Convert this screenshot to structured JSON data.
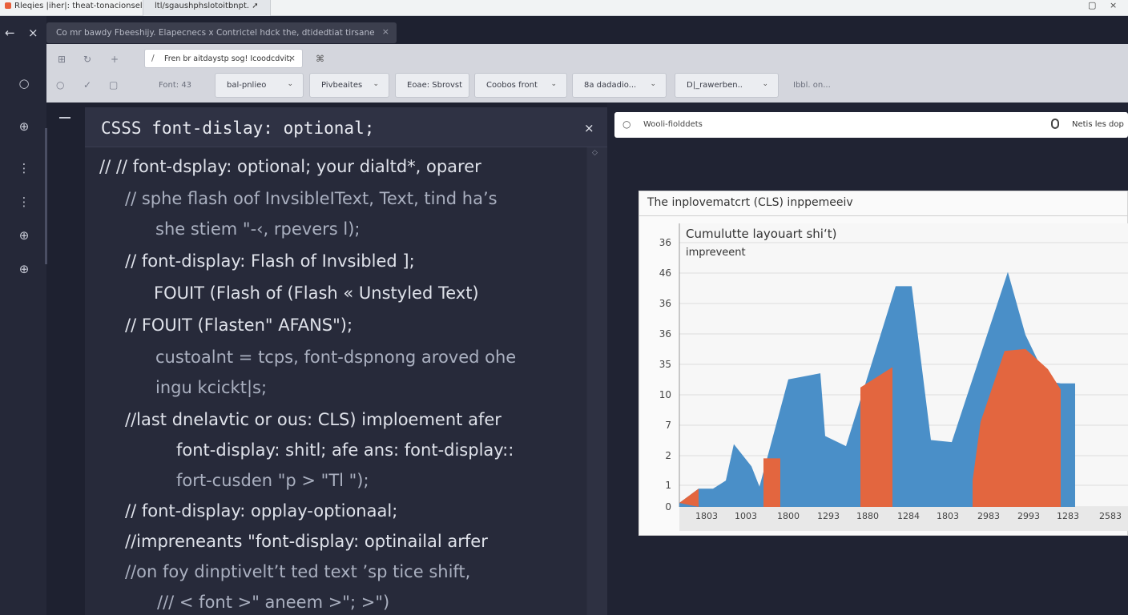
{
  "browser": {
    "tab1_title": "Rleqies |iher|: theat-tonacionsel",
    "tab2_title": "ltl/sgaushphslotoitbnpt.",
    "tab2_icon": "share-icon",
    "window_controls": [
      "▢",
      "×"
    ]
  },
  "header": {
    "address_text": "Co mr bawdy Fbeeshijy. Elapecnecs x Contrictel hdck the, dtidedtiat tirsane",
    "back_icon": "←",
    "close_icon": "×",
    "addr_close": "×"
  },
  "rail": {
    "icons": [
      "○",
      "⊕",
      "⋮",
      "⋮",
      "⊕",
      "⊕"
    ]
  },
  "toolbar": {
    "search_value": "Fren br aitdaystp sog! Icoodcdvit;",
    "search_lead_icon": "/",
    "search_close": "×",
    "extra_icon": "⌘",
    "font_label": "Font: 43",
    "dropdowns": [
      {
        "label": "bal-pnlieo",
        "chevron": true
      },
      {
        "label": "Pivbeaites",
        "chevron": true
      },
      {
        "label": "Eoae: Sbrovst",
        "chevron": false
      },
      {
        "label": "Coobos front",
        "chevron": true
      },
      {
        "label": "8a  dadadio...",
        "chevron": true
      },
      {
        "label": "D|_rawerben..",
        "chevron": true
      }
    ],
    "trailing_label": "Ibbl. on..."
  },
  "editor": {
    "title": "CSSS font-dislay: optional;",
    "close": "×",
    "scroll_marker": "◇",
    "lines": [
      {
        "text": "// // font-dsplay: optional;  your dialtd*, oparer",
        "dim": false
      },
      {
        "text": "//  sphe flash oof InvsibleIText, Text, tind  ha’s",
        "dim": true
      },
      {
        "text": "she  stiem  \"-‹, rpevers l);",
        "dim": true
      },
      {
        "text": "//  font-display: Flash of Invsibled ];",
        "dim": false
      },
      {
        "text": "FOUIT (Flash of (Flash «  Unstyled Text)",
        "dim": false
      },
      {
        "text": "//  FOUIT (Flasten\" AFANS\");",
        "dim": false
      },
      {
        "text": "custoalnt = tcps, font-dspnong  aroved  ohe",
        "dim": true
      },
      {
        "text": "ingu kcickt|s;",
        "dim": true
      },
      {
        "text": "//last  dnelavtic  or  ous: CLS) imploement  afer",
        "dim": false
      },
      {
        "text": "font-display: shitl;  afe  ans:  font-display::",
        "dim": false
      },
      {
        "text": "fort-cusden  \"p  >  \"Tl \");",
        "dim": true
      },
      {
        "text": "//   font-display: opplay-optionaal;",
        "dim": false
      },
      {
        "text": "//impreneants  \"font-display: optinailal  arfer",
        "dim": false
      },
      {
        "text": "//on  foy  dinptivelt’t ted  text  ’sp  tice  shift,",
        "dim": true
      },
      {
        "text": "/// <  font  >\"   aneem  >\";  >\")",
        "dim": true
      }
    ]
  },
  "right_panel": {
    "input_icon": "○",
    "input_text": "Wooli-fiolddets",
    "input_right": "Netis  les dop"
  },
  "chart_data": {
    "type": "area",
    "title": "The inplovematcrt (CLS) inppemeeiv",
    "annotation": "Cumulutte layouart shiʻt) impreveent",
    "y_tick_labels": [
      "36",
      "46",
      "36",
      "36",
      "35",
      "10",
      "7",
      "2",
      "1",
      "0"
    ],
    "x_tick_labels": [
      "1803",
      "1003",
      "1800",
      "1293",
      "1880",
      "1284",
      "1803",
      "2983",
      "2993",
      "1283",
      "2583"
    ],
    "series": [
      {
        "color": "#4a8fc8",
        "y": [
          0.2,
          0.9,
          3.1,
          1.0,
          6.3,
          3.5,
          1.5,
          11.9,
          9.3,
          3.3,
          1.6,
          10.8,
          1.8,
          9.5,
          3.5
        ]
      },
      {
        "color": "#e3663f",
        "y": [
          1.5,
          0.8,
          2.1,
          5.9,
          9.2,
          1.6,
          6.0,
          10.7,
          4.7
        ]
      }
    ],
    "ylim": [
      0,
      14
    ],
    "grid": true,
    "colors": {
      "blue": "#4a8fc8",
      "orange": "#e3663f"
    }
  }
}
